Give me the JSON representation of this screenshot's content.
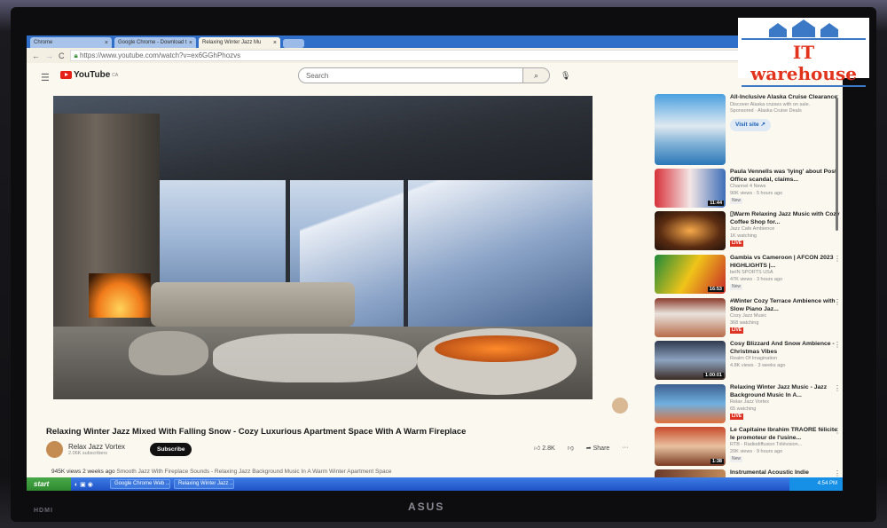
{
  "browser": {
    "tabs": [
      {
        "label": "Chrome"
      },
      {
        "label": "Google Chrome - Download t"
      },
      {
        "label": "Relaxing Winter Jazz Mu"
      }
    ],
    "url": "https://www.youtube.com/watch?v=ex6GGhPhozvs"
  },
  "youtube": {
    "logo": "YouTube",
    "region": "CA",
    "search_placeholder": "Search"
  },
  "video": {
    "title": "Relaxing Winter Jazz Mixed With Falling Snow - Cozy Luxurious Apartment Space With A Warm Fireplace",
    "channel": "Relax Jazz Vortex",
    "subscribers": "2.06K subscribers",
    "subscribe_label": "Subscribe",
    "likes": "2.8K",
    "share_label": "Share",
    "views": "945K views",
    "age": "2 weeks ago",
    "description": "Smooth Jazz With Fireplace Sounds - Relaxing Jazz Background Music In A Warm Winter Apartment Space"
  },
  "sidebar": {
    "ad": {
      "title": "All-Inclusive Alaska Cruise Clearance",
      "desc": "Discover Alaska cruises with on sale.",
      "sponsor": "Sponsored · Alaska Cruise Deals",
      "button": "Visit site"
    },
    "items": [
      {
        "title": "Paula Vennells was 'lying' about Post Office scandal, claims...",
        "channel": "Channel 4 News",
        "stats": "90K views · 5 hours ago",
        "badge": "New",
        "duration": "11:44"
      },
      {
        "title": "▯Warm Relaxing Jazz Music with Cozy Coffee Shop for...",
        "channel": "Jazz Cafe Ambience",
        "stats": "1K watching",
        "badge": "LIVE",
        "duration": ""
      },
      {
        "title": "Gambia vs Cameroon | AFCON 2023 HIGHLIGHTS |...",
        "channel": "beIN SPORTS USA",
        "stats": "47K views · 3 hours ago",
        "badge": "New",
        "duration": "16:53"
      },
      {
        "title": "#Winter Cozy Terrace Ambience with Slow Piano Jaz...",
        "channel": "Cozy Jazz Music",
        "stats": "368 watching",
        "badge": "LIVE",
        "duration": ""
      },
      {
        "title": "Cosy Blizzard And Snow Ambience - Christmas Vibes",
        "channel": "Realm Of Imagination",
        "stats": "4.8K views · 3 weeks ago",
        "badge": "",
        "duration": "1:00:01"
      },
      {
        "title": "Relaxing Winter Jazz Music - Jazz Background Music In A...",
        "channel": "Relax Jazz Vortex",
        "stats": "65 watching",
        "badge": "LIVE",
        "duration": ""
      },
      {
        "title": "Le Capitaine Ibrahim TRAORE félicite le promoteur de l'usine...",
        "channel": "RTB - Radiodiffusion Télévision...",
        "stats": "20K views · 9 hours ago",
        "badge": "New",
        "duration": "1:38"
      },
      {
        "title": "Instrumental Acoustic Indie",
        "channel": "",
        "stats": "",
        "badge": "",
        "duration": ""
      }
    ]
  },
  "taskbar": {
    "start": "start",
    "tasks": [
      "Google Chrome Web ...",
      "Relaxing Winter Jazz ..."
    ],
    "clock": "4:54 PM"
  },
  "monitor": {
    "input": "HDMI",
    "brand": "ASUS"
  },
  "watermark": {
    "text": "IT warehouse"
  },
  "colors": {
    "accent": "#e62117",
    "taskbar": "#245edb",
    "live": "#dd3322",
    "watermark": "#e2331d"
  }
}
